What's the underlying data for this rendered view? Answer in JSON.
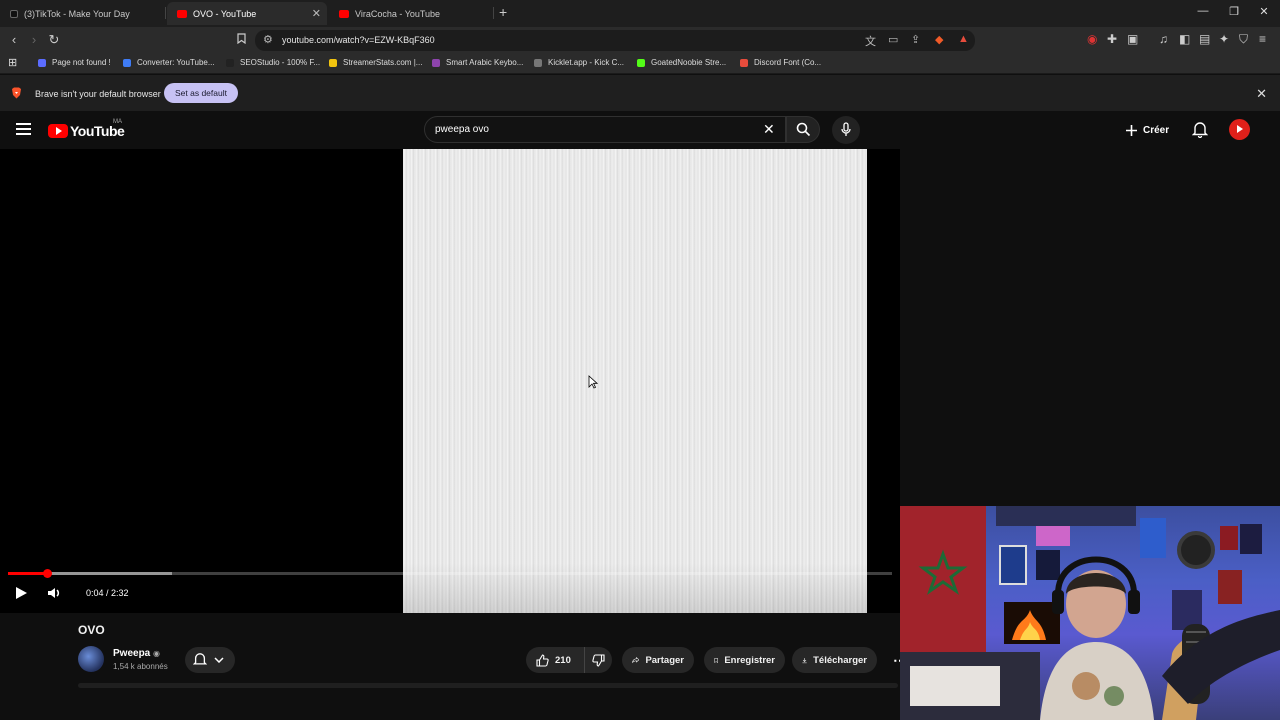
{
  "browser": {
    "tabs": [
      {
        "title": "(3)TikTok - Make Your Day",
        "icon": "tiktok-icon"
      },
      {
        "title": "OVO - YouTube",
        "icon": "youtube-icon",
        "active": true
      },
      {
        "title": "ViraCocha - YouTube",
        "icon": "youtube-icon"
      }
    ],
    "url": "youtube.com/watch?v=EZW-KBqF360",
    "bookmarks": [
      {
        "label": "Page not found !",
        "color": "#5b6cff"
      },
      {
        "label": "Converter: YouTube...",
        "color": "#3f7cf6"
      },
      {
        "label": "SEOStudio - 100% F...",
        "color": "#222"
      },
      {
        "label": "StreamerStats.com |...",
        "color": "#f1c40f"
      },
      {
        "label": "Smart Arabic Keybo...",
        "color": "#8e44ad"
      },
      {
        "label": "Kicklet.app - Kick C...",
        "color": "#777"
      },
      {
        "label": "GoatedNoobie Stre...",
        "color": "#53fc18"
      },
      {
        "label": "Discord Font (Co...",
        "color": "#e74c3c"
      }
    ],
    "infobar": {
      "text": "Brave isn't your default browser",
      "button": "Set as default"
    }
  },
  "youtube": {
    "logo_text": "YouTube",
    "country": "MA",
    "search_value": "pweepa ovo",
    "create_label": "Créer"
  },
  "player": {
    "time": "0:04 / 2:32",
    "played_fraction": 0.044,
    "buffered_fraction": 0.186
  },
  "video": {
    "title": "OVO",
    "channel": "Pweepa",
    "subscribers": "1,54 k abonnés",
    "likes": "210",
    "share": "Partager",
    "save": "Enregistrer",
    "download": "Télécharger"
  },
  "colors": {
    "accent": "#ff0000",
    "infobar_button": "#c7c2f4"
  }
}
